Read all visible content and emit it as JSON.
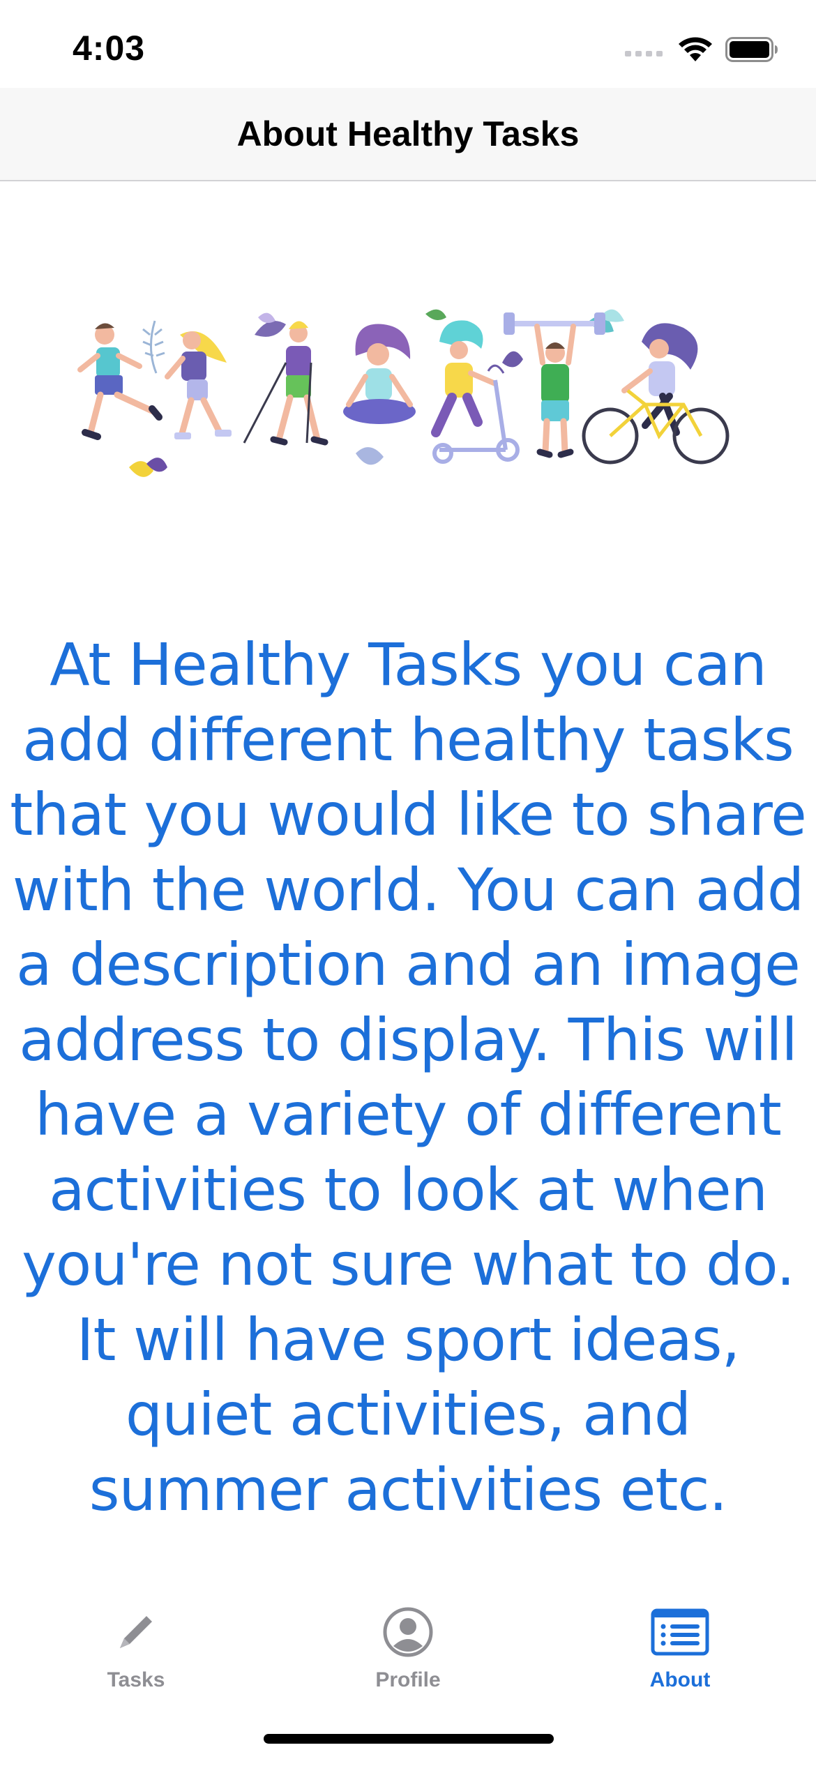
{
  "status_bar": {
    "time": "4:03"
  },
  "nav": {
    "title": "About Healthy Tasks"
  },
  "about": {
    "text": "At Healthy Tasks you can add different healthy tasks that you would like to share with the world. You can add a description and an image address to display. This will have a variety of different activities to look at when you're not sure what to do. It will have sport ideas, quiet activities, and summer activities etc."
  },
  "tabs": [
    {
      "label": "Tasks",
      "icon": "pencil-icon",
      "active": false
    },
    {
      "label": "Profile",
      "icon": "person-circle-icon",
      "active": false
    },
    {
      "label": "About",
      "icon": "list-card-icon",
      "active": true
    }
  ],
  "colors": {
    "accent": "#1c6fd9",
    "inactive": "#8e8e93",
    "nav_background": "#f7f7f7"
  }
}
